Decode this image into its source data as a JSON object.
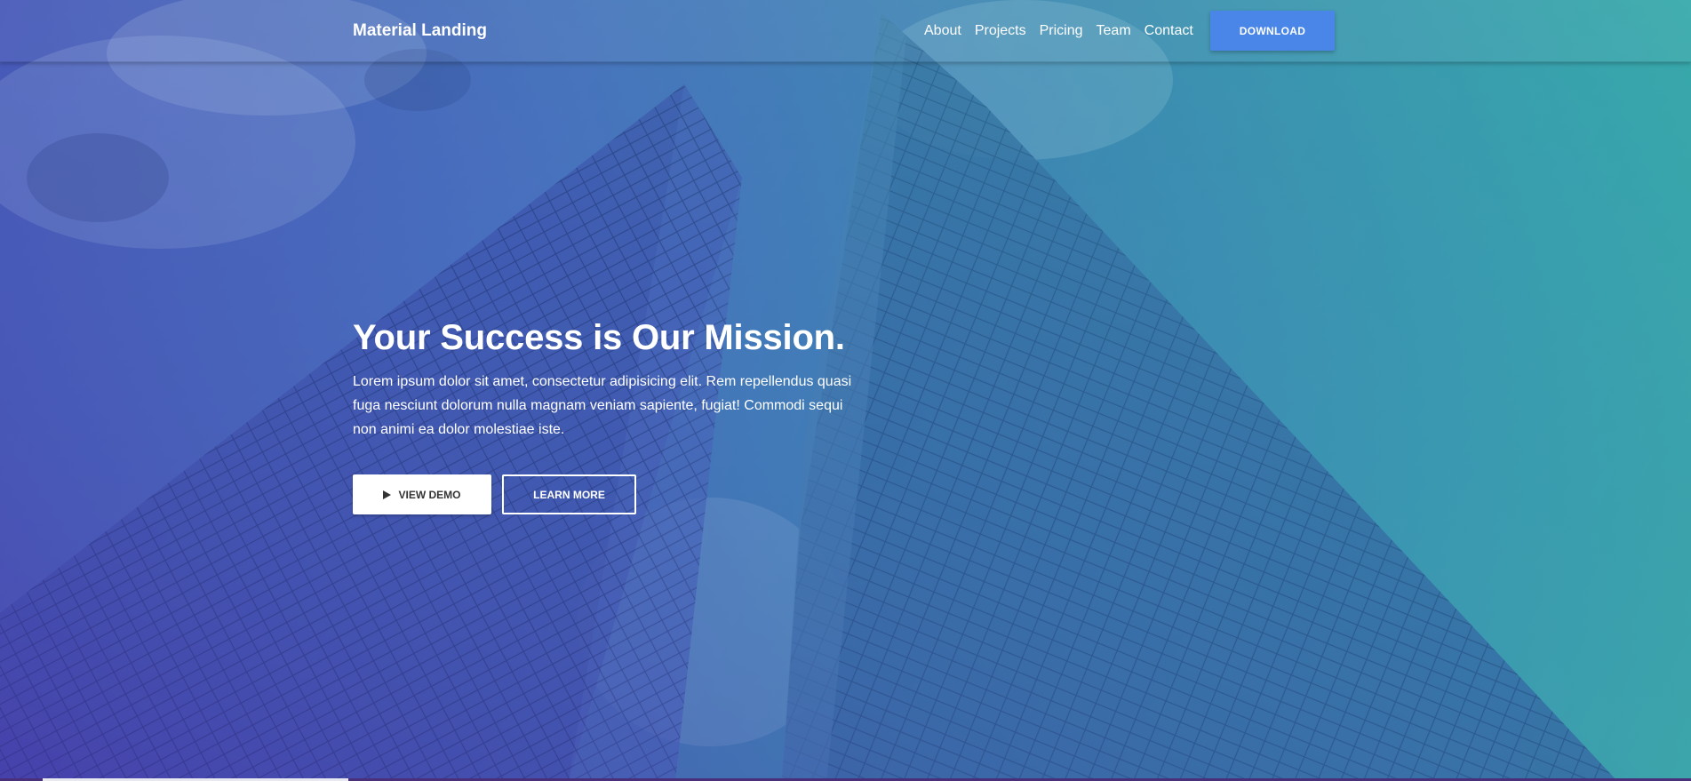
{
  "navbar": {
    "brand": "Material Landing",
    "links": [
      "About",
      "Projects",
      "Pricing",
      "Team",
      "Contact"
    ],
    "download_label": "DOWNLOAD"
  },
  "hero": {
    "headline": "Your Success is Our Mission.",
    "lead": "Lorem ipsum dolor sit amet, consectetur adipisicing elit. Rem repellendus quasi fuga nesciunt dolorum nulla magnam veniam sapiente, fugiat! Commodi sequi non animi ea dolor molestiae iste.",
    "view_demo_label": "VIEW DEMO",
    "learn_more_label": "LEARN MORE"
  },
  "colors": {
    "accent": "#4a86e8",
    "overlay_left": "#4a4fb8",
    "overlay_right": "#3bb3a6"
  },
  "icons": {
    "demo_button_icon": "play-icon"
  }
}
